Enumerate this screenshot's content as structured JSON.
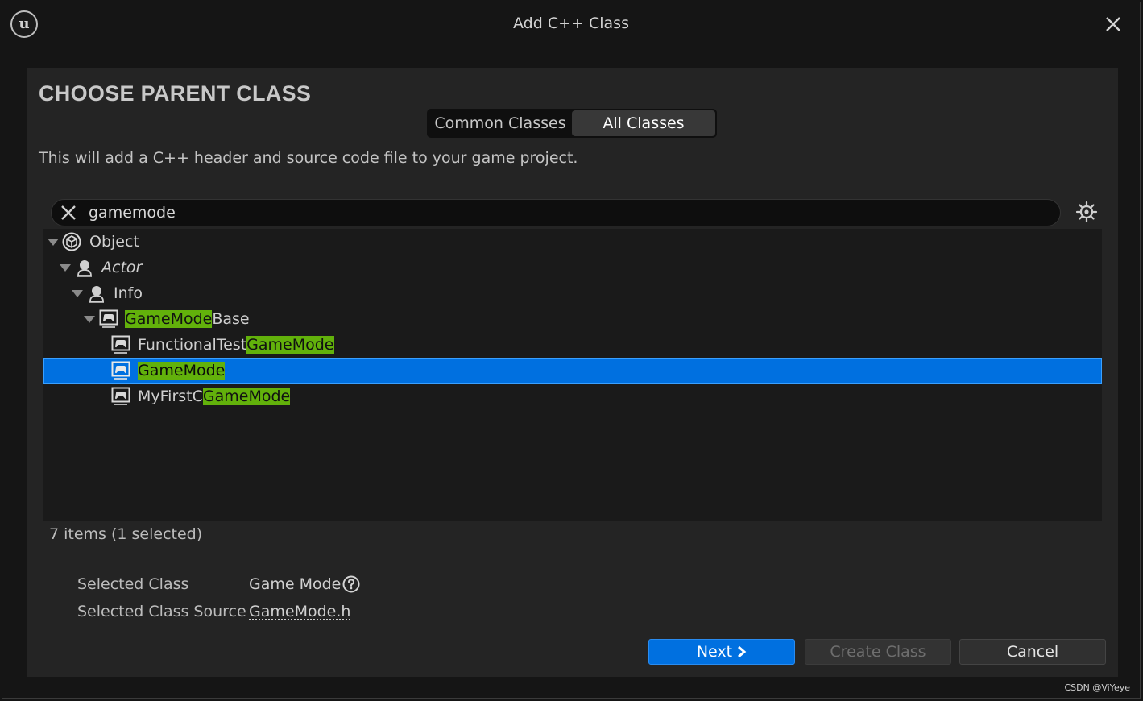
{
  "window": {
    "title": "Add C++ Class",
    "logo_icon": "unreal-engine-logo",
    "close_icon": "close-icon"
  },
  "page": {
    "heading": "CHOOSE PARENT CLASS",
    "tabs": [
      {
        "label": "Common Classes",
        "active": false
      },
      {
        "label": "All Classes",
        "active": true
      }
    ],
    "description": "This will add a C++ header and source code file to your game project."
  },
  "search": {
    "value": "gamemode",
    "clear_icon": "close-icon",
    "settings_icon": "gear-icon"
  },
  "tree": {
    "highlight_color": "#62b10b",
    "selected_color": "#0070e0",
    "rows": [
      {
        "pre": "Object",
        "match": "",
        "post": "",
        "icon": "object-icon",
        "expanded": true,
        "italic": false
      },
      {
        "pre": "Actor",
        "match": "",
        "post": "",
        "icon": "actor-icon",
        "expanded": true,
        "italic": true
      },
      {
        "pre": "Info",
        "match": "",
        "post": "",
        "icon": "actor-icon",
        "expanded": true,
        "italic": false
      },
      {
        "pre": "",
        "match": "GameMode",
        "post": "Base",
        "icon": "gamemode-icon",
        "expanded": true,
        "italic": false
      },
      {
        "pre": "FunctionalTest",
        "match": "GameMode",
        "post": "",
        "icon": "gamemode-icon",
        "expanded": false,
        "italic": false
      },
      {
        "pre": "",
        "match": "GameMode",
        "post": "",
        "icon": "gamemode-icon",
        "expanded": false,
        "italic": false,
        "selected": true
      },
      {
        "pre": "MyFirstC",
        "match": "GameMode",
        "post": "",
        "icon": "gamemode-icon",
        "expanded": false,
        "italic": false
      }
    ]
  },
  "status": {
    "items_count": "7 items (1 selected)"
  },
  "details": {
    "selected_class_label": "Selected Class",
    "selected_class_value": "Game Mode",
    "selected_class_source_label": "Selected Class Source",
    "selected_class_source_value": "GameMode.h",
    "help_icon": "help-icon"
  },
  "buttons": {
    "next": "Next",
    "next_icon": "chevron-right-icon",
    "create": "Create Class",
    "cancel": "Cancel"
  },
  "watermark": "CSDN @ViYeye"
}
